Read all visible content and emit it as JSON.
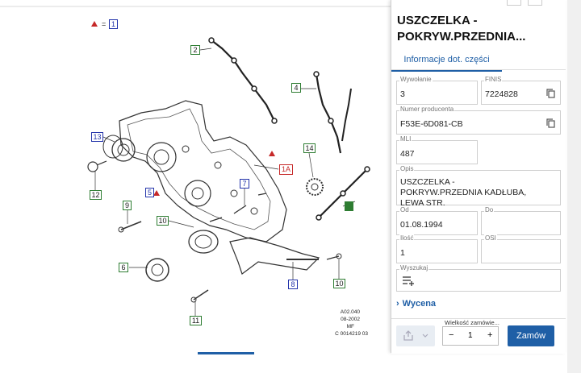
{
  "diagram": {
    "legend": {
      "symbol": "▲",
      "equals": "=",
      "ref": "1"
    },
    "callouts": [
      {
        "label": "2"
      },
      {
        "label": "4"
      },
      {
        "label": "13"
      },
      {
        "label": "14"
      },
      {
        "label": "1A"
      },
      {
        "label": "12"
      },
      {
        "label": "5"
      },
      {
        "label": "7"
      },
      {
        "label": "9"
      },
      {
        "label": "3"
      },
      {
        "label": "10"
      },
      {
        "label": "6"
      },
      {
        "label": "8"
      },
      {
        "label": "10"
      },
      {
        "label": "11"
      }
    ],
    "meta": [
      "A02.040",
      "08-2002",
      "MF",
      "C 0014219 03"
    ]
  },
  "panel": {
    "title": "USZCZELKA - POKRYW.PRZEDNIA...",
    "tab": "Informacje dot. części",
    "fields": {
      "wywolanie": {
        "label": "Wywołanie",
        "value": "3"
      },
      "finis": {
        "label": "FINIS",
        "value": "7224828"
      },
      "numer": {
        "label": "Numer producenta",
        "value": "F53E-6D081-CB"
      },
      "mli": {
        "label": "MLI",
        "value": "487"
      },
      "opis": {
        "label": "Opis",
        "value": "USZCZELKA - POKRYW.PRZEDNIA KADŁUBA, LEWA STR."
      },
      "od": {
        "label": "Od",
        "value": "01.08.1994"
      },
      "do": {
        "label": "Do",
        "value": ""
      },
      "ilosc": {
        "label": "Ilość",
        "value": "1"
      },
      "osi": {
        "label": "OSI",
        "value": ""
      },
      "wyszukaj": {
        "label": "Wyszukaj"
      }
    },
    "wycena": "Wycena",
    "quantity": {
      "label": "Wielkość zamówie...",
      "minus": "−",
      "value": "1",
      "plus": "+"
    },
    "order_button": "Zamów"
  }
}
